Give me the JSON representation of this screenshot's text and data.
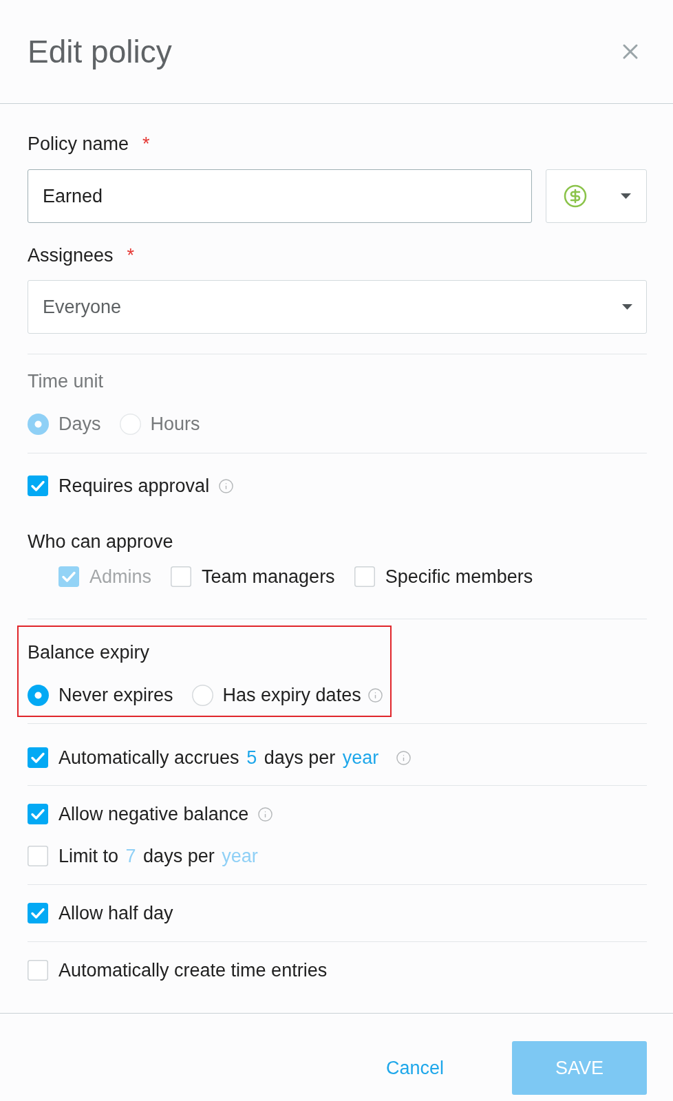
{
  "dialog": {
    "title": "Edit policy"
  },
  "policy_name": {
    "label": "Policy name",
    "required_mark": "*",
    "value": "Earned"
  },
  "assignees": {
    "label": "Assignees",
    "required_mark": "*",
    "value": "Everyone"
  },
  "time_unit": {
    "label": "Time unit",
    "disabled": true,
    "options": [
      {
        "label": "Days",
        "selected": true
      },
      {
        "label": "Hours",
        "selected": false
      }
    ]
  },
  "requires_approval": {
    "label": "Requires approval",
    "checked": true,
    "info": true
  },
  "who_can_approve": {
    "label": "Who can approve",
    "options": [
      {
        "label": "Admins",
        "checked": true,
        "disabled": true
      },
      {
        "label": "Team managers",
        "checked": false,
        "disabled": false
      },
      {
        "label": "Specific members",
        "checked": false,
        "disabled": false
      }
    ]
  },
  "balance_expiry": {
    "label": "Balance expiry",
    "highlighted": true,
    "options": [
      {
        "label": "Never expires",
        "selected": true,
        "info": false
      },
      {
        "label": "Has expiry dates",
        "selected": false,
        "info": true
      }
    ]
  },
  "sections": [
    {
      "rows": [
        {
          "checked": true,
          "info": true,
          "segments": [
            {
              "kind": "text",
              "text": "Automatically accrues"
            },
            {
              "kind": "link",
              "text": "5",
              "disabled": false
            },
            {
              "kind": "text",
              "text": "days per"
            },
            {
              "kind": "link",
              "text": "year",
              "disabled": false
            }
          ]
        }
      ]
    },
    {
      "rows": [
        {
          "checked": true,
          "info": true,
          "segments": [
            {
              "kind": "text",
              "text": "Allow negative balance"
            }
          ]
        },
        {
          "checked": false,
          "info": false,
          "segments": [
            {
              "kind": "text",
              "text": "Limit to"
            },
            {
              "kind": "link",
              "text": "7",
              "disabled": true
            },
            {
              "kind": "text",
              "text": "days per"
            },
            {
              "kind": "link",
              "text": "year",
              "disabled": true
            }
          ]
        }
      ]
    },
    {
      "rows": [
        {
          "checked": true,
          "info": false,
          "segments": [
            {
              "kind": "text",
              "text": "Allow half day"
            }
          ]
        }
      ]
    },
    {
      "rows": [
        {
          "checked": false,
          "info": false,
          "segments": [
            {
              "kind": "text",
              "text": "Automatically create time entries"
            }
          ]
        }
      ]
    }
  ],
  "footer": {
    "buttons": [
      {
        "kind": "text",
        "label": "Cancel",
        "disabled": false
      },
      {
        "kind": "primary",
        "label": "SAVE",
        "disabled": true
      }
    ]
  }
}
